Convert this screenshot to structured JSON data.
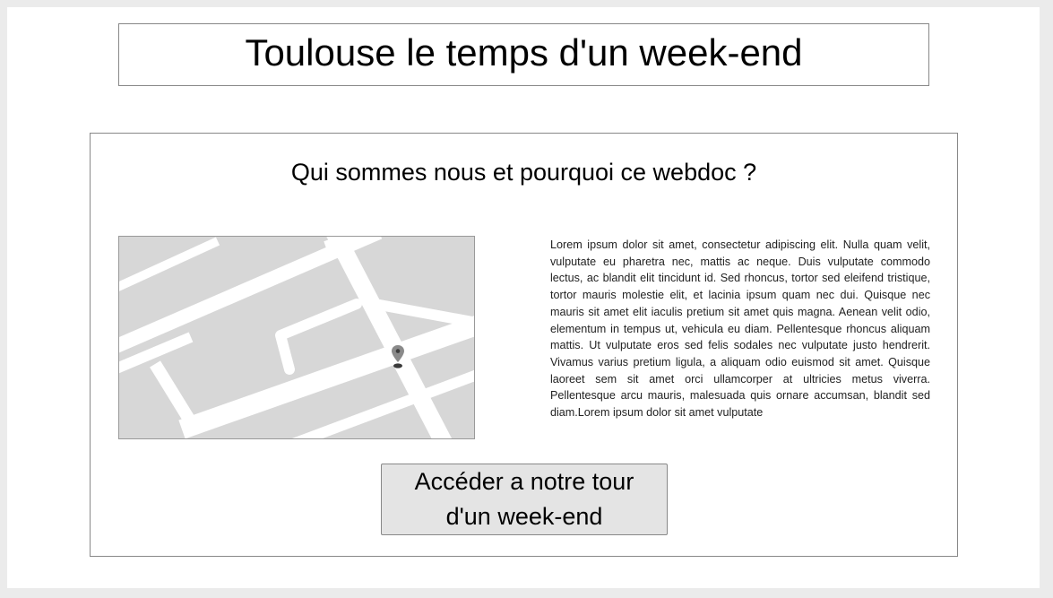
{
  "header": {
    "title": "Toulouse le temps d'un week-end"
  },
  "about": {
    "heading": "Qui sommes nous et pourquoi ce webdoc ?",
    "body": "Lorem ipsum dolor sit amet, consectetur adipiscing elit. Nulla quam velit, vulputate eu pharetra nec, mattis ac neque. Duis vulputate commodo lectus, ac blandit elit tincidunt id. Sed rhoncus, tortor sed eleifend tristique, tortor mauris molestie elit, et lacinia ipsum quam nec dui. Quisque nec mauris sit amet elit iaculis pretium sit amet quis magna. Aenean velit odio, elementum in tempus ut, vehicula eu diam. Pellentesque rhoncus aliquam mattis. Ut vulputate eros sed felis sodales nec vulputate justo hendrerit. Vivamus varius pretium ligula, a aliquam odio euismod sit amet. Quisque laoreet sem sit amet orci ullamcorper at ultricies metus viverra. Pellentesque arcu mauris, malesuada quis ornare accumsan, blandit sed diam.Lorem ipsum dolor sit amet vulputate",
    "map_icon": "map-pin-icon"
  },
  "cta": {
    "label": "Accéder a notre tour d'un week-end"
  },
  "colors": {
    "page_background": "#ebebeb",
    "map_background": "#d7d7d7",
    "map_roads": "#ffffff",
    "pin": "#888888",
    "button_background": "#e4e4e4",
    "border": "#888888"
  }
}
